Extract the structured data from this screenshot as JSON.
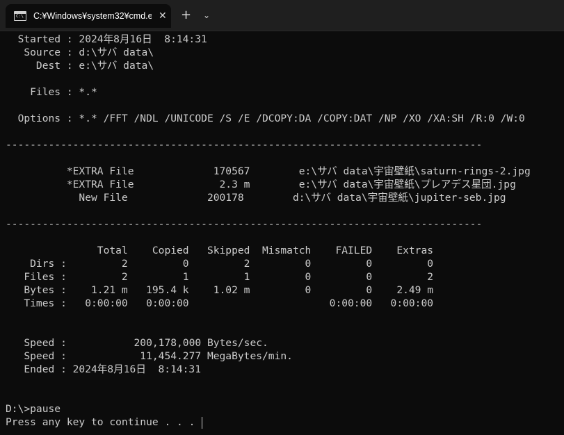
{
  "window": {
    "tab_title": "C:¥Windows¥system32¥cmd.e",
    "tab_icon_text": "C:\\",
    "close_glyph": "✕",
    "new_tab_glyph": "+",
    "dropdown_glyph": "⌄"
  },
  "terminal": {
    "lines": [
      "  Started : 2024年8月16日  8:14:31",
      "   Source : d:\\サバ data\\",
      "     Dest : e:\\サバ data\\",
      "",
      "    Files : *.*",
      "",
      "  Options : *.* /FFT /NDL /UNICODE /S /E /DCOPY:DA /COPY:DAT /NP /XO /XA:SH /R:0 /W:0",
      "",
      "------------------------------------------------------------------------------",
      "",
      "          *EXTRA File             170567        e:\\サバ data\\宇宙壁紙\\saturn-rings-2.jpg",
      "          *EXTRA File              2.3 m        e:\\サバ data\\宇宙壁紙\\プレアデス星団.jpg",
      "            New File             200178        d:\\サバ data\\宇宙壁紙\\jupiter-seb.jpg",
      "",
      "------------------------------------------------------------------------------",
      "",
      "               Total    Copied   Skipped  Mismatch    FAILED    Extras",
      "    Dirs :         2         0         2         0         0         0",
      "   Files :         2         1         1         0         0         2",
      "   Bytes :    1.21 m   195.4 k    1.02 m         0         0    2.49 m",
      "   Times :   0:00:00   0:00:00                       0:00:00   0:00:00",
      "",
      "",
      "   Speed :           200,178,000 Bytes/sec.",
      "   Speed :            11,454.277 MegaBytes/min.",
      "   Ended : 2024年8月16日  8:14:31",
      "",
      "",
      "D:\\>pause",
      "Press any key to continue . . . "
    ]
  }
}
